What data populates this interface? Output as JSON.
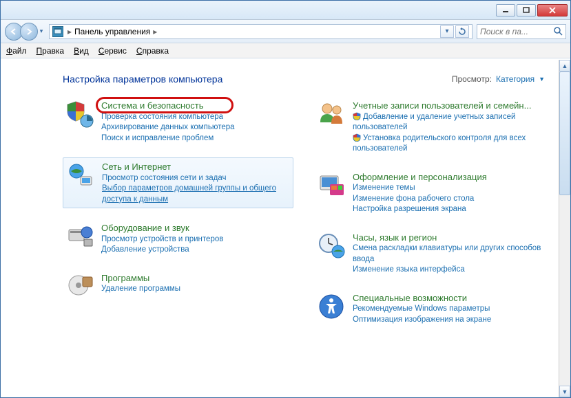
{
  "titlebar": {
    "minimize": "–",
    "maximize": "▢",
    "close": "✕"
  },
  "nav": {
    "back": "◄",
    "forward": "►"
  },
  "breadcrumb": {
    "root": "Панель управления",
    "sep": "▸"
  },
  "search": {
    "placeholder": "Поиск в па..."
  },
  "menu": {
    "file_u": "Ф",
    "file_rest": "айл",
    "edit_u": "П",
    "edit_rest": "равка",
    "view_u": "В",
    "view_rest": "ид",
    "service_u": "С",
    "service_rest": "ервис",
    "help_u": "С",
    "help_rest": "правка"
  },
  "heading": "Настройка параметров компьютера",
  "viewsel": {
    "label": "Просмотр:",
    "value": "Категория"
  },
  "categories": {
    "system": {
      "title": "Система и безопасность",
      "subs": [
        "Проверка состояния компьютера",
        "Архивирование данных компьютера",
        "Поиск и исправление проблем"
      ]
    },
    "network": {
      "title": "Сеть и Интернет",
      "subs": [
        "Просмотр состояния сети и задач",
        "Выбор параметров домашней группы и общего доступа к данным"
      ]
    },
    "hardware": {
      "title": "Оборудование и звук",
      "subs": [
        "Просмотр устройств и принтеров",
        "Добавление устройства"
      ]
    },
    "programs": {
      "title": "Программы",
      "subs": [
        "Удаление программы"
      ]
    },
    "users": {
      "title": "Учетные записи пользователей и семейн...",
      "subs": [
        "Добавление и удаление учетных записей пользователей",
        "Установка родительского контроля для всех пользователей"
      ]
    },
    "appearance": {
      "title": "Оформление и персонализация",
      "subs": [
        "Изменение темы",
        "Изменение фона рабочего стола",
        "Настройка разрешения экрана"
      ]
    },
    "clock": {
      "title": "Часы, язык и регион",
      "subs": [
        "Смена раскладки клавиатуры или других способов ввода",
        "Изменение языка интерфейса"
      ]
    },
    "access": {
      "title": "Специальные возможности",
      "subs": [
        "Рекомендуемые Windows параметры",
        "Оптимизация изображения на экране"
      ]
    }
  }
}
